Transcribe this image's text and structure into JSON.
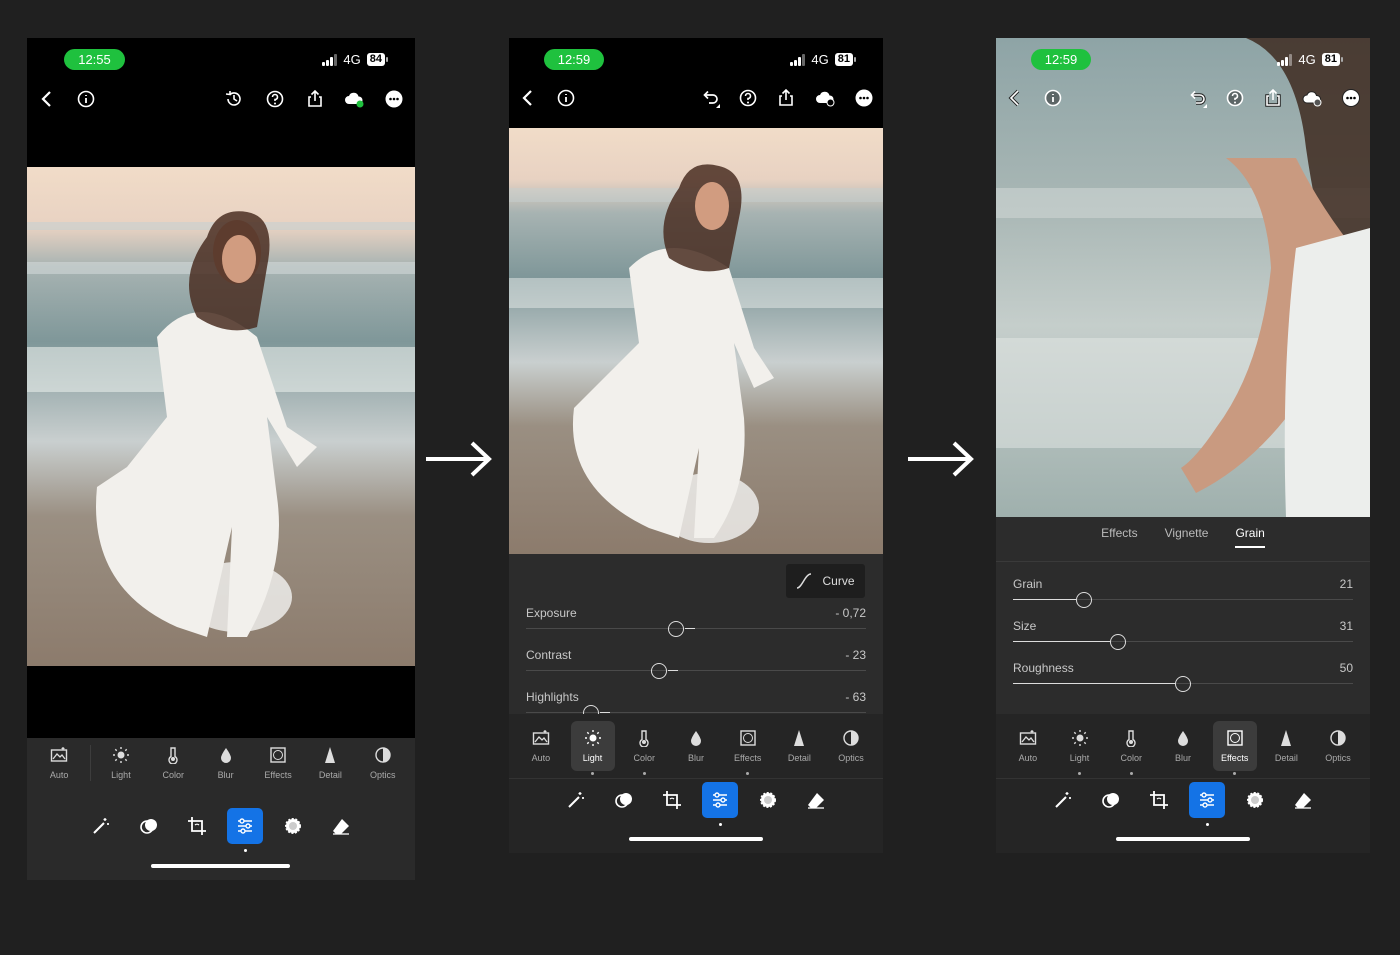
{
  "screens": [
    {
      "time": "12:55",
      "network": "4G",
      "battery": "84",
      "tools": [
        {
          "label": "Auto",
          "icon": "auto-icon"
        },
        {
          "label": "Light",
          "icon": "light-icon"
        },
        {
          "label": "Color",
          "icon": "color-icon"
        },
        {
          "label": "Blur",
          "icon": "blur-icon"
        },
        {
          "label": "Effects",
          "icon": "effects-icon"
        },
        {
          "label": "Detail",
          "icon": "detail-icon"
        },
        {
          "label": "Optics",
          "icon": "optics-icon"
        }
      ]
    },
    {
      "time": "12:59",
      "network": "4G",
      "battery": "81",
      "curve_label": "Curve",
      "sliders": [
        {
          "label": "Exposure",
          "value": "- 0,72",
          "level": 0.44
        },
        {
          "label": "Contrast",
          "value": "- 23",
          "level": 0.39
        },
        {
          "label": "Highlights",
          "value": "- 63",
          "level": 0.19
        }
      ],
      "tools": [
        {
          "label": "Auto"
        },
        {
          "label": "Light"
        },
        {
          "label": "Color"
        },
        {
          "label": "Blur"
        },
        {
          "label": "Effects"
        },
        {
          "label": "Detail"
        },
        {
          "label": "Optics"
        }
      ],
      "active_tool": "Light"
    },
    {
      "time": "12:59",
      "network": "4G",
      "battery": "81",
      "tabs": [
        "Effects",
        "Vignette",
        "Grain"
      ],
      "active_tab": "Grain",
      "sliders": [
        {
          "label": "Grain",
          "value": "21",
          "level": 0.21
        },
        {
          "label": "Size",
          "value": "31",
          "level": 0.31
        },
        {
          "label": "Roughness",
          "value": "50",
          "level": 0.5
        }
      ],
      "tools": [
        {
          "label": "Auto"
        },
        {
          "label": "Light"
        },
        {
          "label": "Color"
        },
        {
          "label": "Blur"
        },
        {
          "label": "Effects"
        },
        {
          "label": "Detail"
        },
        {
          "label": "Optics"
        }
      ],
      "active_tool": "Effects"
    }
  ],
  "bottom_tools": [
    "magic-wand-icon",
    "masking-icon",
    "crop-icon",
    "adjust-icon",
    "healing-icon",
    "eraser-icon"
  ],
  "colors": {
    "accent": "#1473e6",
    "clock_pill": "#1fc13e",
    "panel": "#2a2a2a",
    "background": "#202020"
  }
}
